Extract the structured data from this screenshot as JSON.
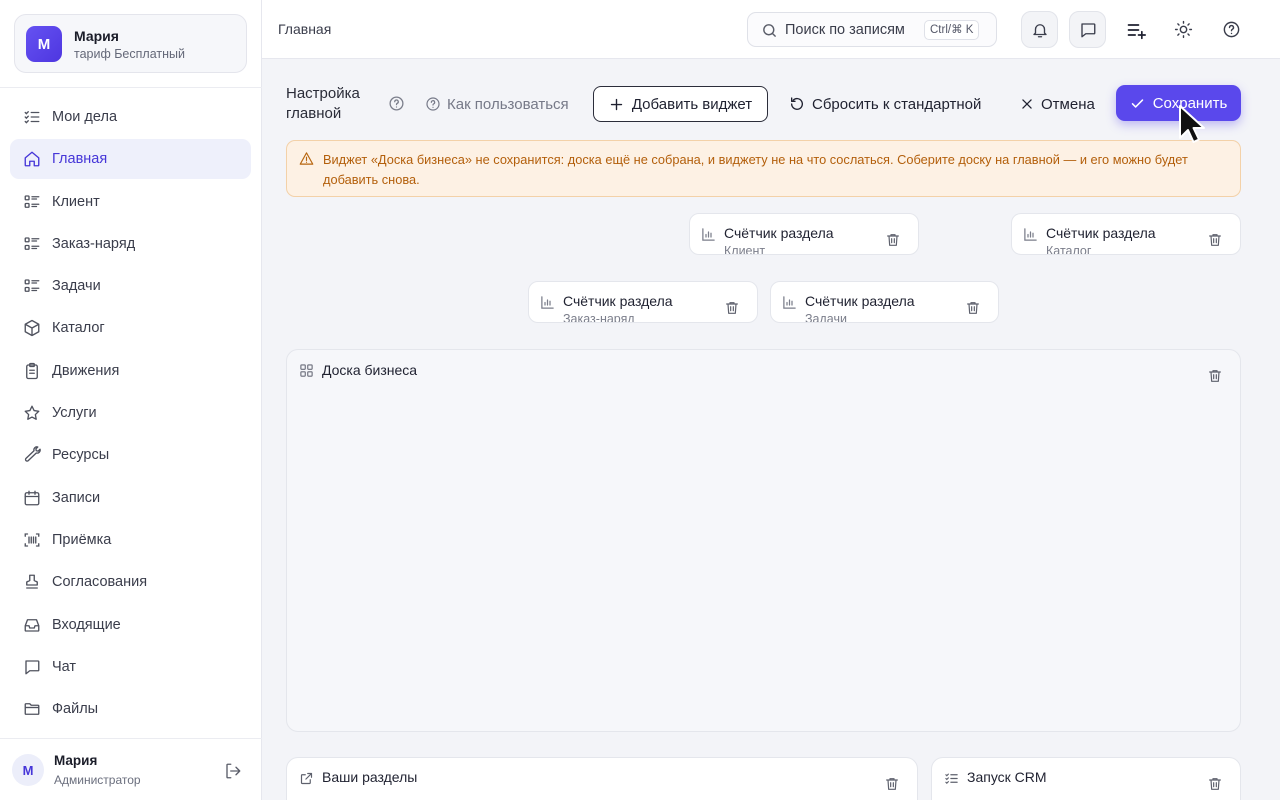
{
  "account": {
    "avatar_letter": "М",
    "name": "Мария",
    "plan": "тариф Бесплатный"
  },
  "nav": {
    "items": [
      {
        "label": "Мои дела",
        "icon": "task-list-icon"
      },
      {
        "label": "Главная",
        "icon": "home-icon",
        "active": true
      },
      {
        "label": "Клиент",
        "icon": "list-icon"
      },
      {
        "label": "Заказ-наряд",
        "icon": "list-icon"
      },
      {
        "label": "Задачи",
        "icon": "list-icon"
      },
      {
        "label": "Каталог",
        "icon": "box-icon"
      },
      {
        "label": "Движения",
        "icon": "clipboard-icon"
      },
      {
        "label": "Услуги",
        "icon": "star-icon"
      },
      {
        "label": "Ресурсы",
        "icon": "wrench-icon"
      },
      {
        "label": "Записи",
        "icon": "calendar-icon"
      },
      {
        "label": "Приёмка",
        "icon": "barcode-scan-icon"
      },
      {
        "label": "Согласования",
        "icon": "stamp-icon"
      },
      {
        "label": "Входящие",
        "icon": "inbox-icon"
      },
      {
        "label": "Чат",
        "icon": "chat-icon"
      },
      {
        "label": "Файлы",
        "icon": "folder-icon"
      }
    ]
  },
  "user": {
    "avatar_letter": "М",
    "name": "Мария",
    "role": "Администратор"
  },
  "topbar": {
    "breadcrumb": "Главная",
    "search_placeholder": "Поиск по записям",
    "search_shortcut": "Ctrl/⌘ K"
  },
  "toolbar": {
    "title_line1": "Настройка",
    "title_line2": "главной",
    "howto_label": "Как пользоваться",
    "add_widget_label": "Добавить виджет",
    "reset_label": "Сбросить к стандартной",
    "cancel_label": "Отмена",
    "save_label": "Сохранить"
  },
  "warning": {
    "text": "Виджет «Доска бизнеса» не сохранится: доска ещё не собрана, и виджету не на что сослаться. Соберите доску на главной — и его можно будет добавить снова."
  },
  "widgets": {
    "counters": [
      {
        "title": "Счётчик раздела",
        "subtitle": "Клиент"
      },
      {
        "title": "Счётчик раздела",
        "subtitle": "Каталог"
      },
      {
        "title": "Счётчик раздела",
        "subtitle": "Заказ-наряд"
      },
      {
        "title": "Счётчик раздела",
        "subtitle": "Задачи"
      }
    ],
    "board_title": "Доска бизнеса",
    "your_sections_title": "Ваши разделы",
    "crm_launch_title": "Запуск CRM"
  },
  "colors": {
    "accent": "#5a48ec",
    "warning_bg": "#fdf1e4",
    "warning_text": "#b35f0b",
    "active_nav_bg": "#eef0fb"
  }
}
